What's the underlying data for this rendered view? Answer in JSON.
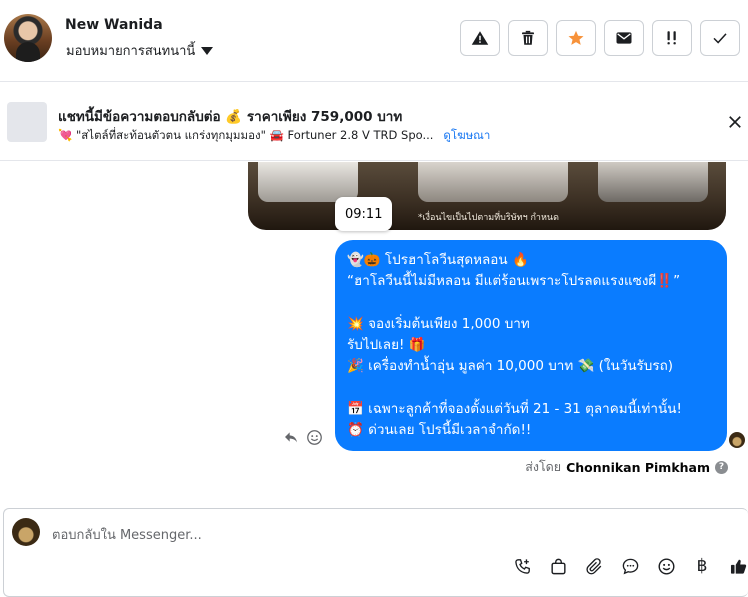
{
  "header": {
    "contact_name": "New Wanida",
    "assign_label": "มอบหมายการสนทนานี้",
    "action_icons": [
      "warning-icon",
      "trash-icon",
      "star-icon",
      "envelope-icon",
      "follow-up-icon",
      "check-icon"
    ],
    "accent_star": "#f7923a"
  },
  "ad_banner": {
    "title": "แชทนี้มีข้อความตอบกลับต่อ 💰 ราคาเพียง 759,000 บาท",
    "subtitle_prefix": "💘 \"สไตล์ที่สะท้อนตัวตน แกร่งทุกมุมมอง\" 🚘 Fortuner 2.8 V TRD Spo...",
    "link_label": "ดูโฆษณา"
  },
  "media": {
    "caption": "*เงื่อนไขเป็นไปตามที่บริษัทฯ กำหนด"
  },
  "timestamp": "09:11",
  "message": {
    "lines": [
      "👻🎃 โปรฮาโลวีนสุดหลอน 🔥",
      "“ฮาโลวีนนี้ไม่มีหลอน มีแต่ร้อนเพราะโปรลดแรงแซงผี‼️”",
      "",
      "💥 จองเริ่มต้นเพียง 1,000 บาท",
      "รับไปเลย! 🎁",
      "🎉 เครื่องทำน้ำอุ่น มูลค่า 10,000 บาท 💸 (ในวันรับรถ)",
      "",
      "📅 เฉพาะลูกค้าที่จองตั้งแต่วันที่ 21 - 31 ตุลาคมนี้เท่านั้น!",
      "⏰ ด่วนเลย โปรนี้มีเวลาจำกัด!!"
    ],
    "bubble_color": "#0a7cff"
  },
  "sent_by": {
    "prefix": "ส่งโดย",
    "name": "Chonnikan Pimkham",
    "help": "?"
  },
  "composer": {
    "placeholder": "ตอบกลับใน Messenger...",
    "tool_icons": [
      "call-add-icon",
      "shopping-bag-icon",
      "paperclip-icon",
      "chat-bubble-icon",
      "emoji-icon",
      "baht-icon",
      "thumbs-up-icon"
    ],
    "baht_symbol": "฿"
  }
}
